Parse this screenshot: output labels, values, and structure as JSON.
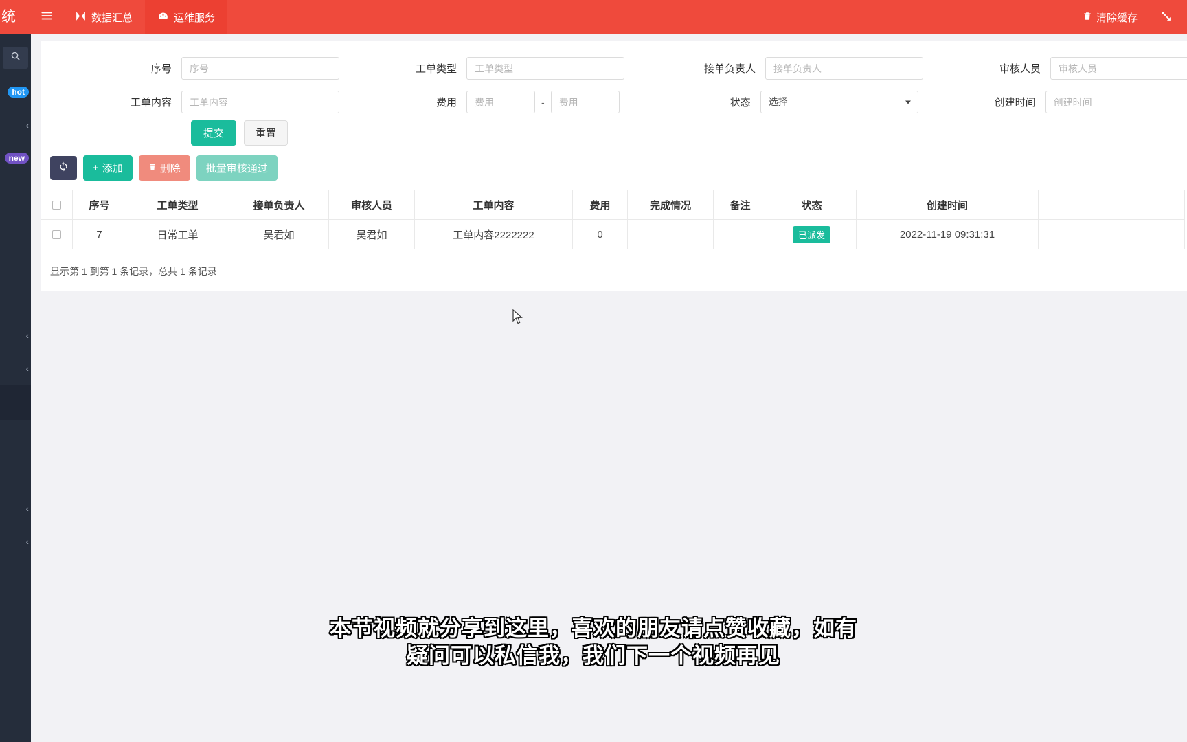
{
  "brand": {
    "title_fragment": "统"
  },
  "header": {
    "menu_toggle_icon": "hamburger-icon",
    "tabs": [
      {
        "label": "数据汇总",
        "icon": "chart-icon"
      },
      {
        "label": "运维服务",
        "icon": "gauge-icon"
      }
    ],
    "clear_cache_label": "清除缓存",
    "clear_cache_icon": "trash-icon",
    "fullscreen_icon": "fullscreen-icon"
  },
  "sidebar": {
    "search_icon": "search-icon",
    "items": [
      {
        "badge": "hot",
        "badge_type": "hot"
      },
      {
        "chevron": "‹"
      },
      {
        "badge": "new",
        "badge_type": "new"
      },
      {
        "chevron": "‹"
      },
      {
        "chevron": "‹"
      },
      {
        "chevron": "‹"
      },
      {
        "chevron": "‹"
      }
    ]
  },
  "search_form": {
    "fields": {
      "serial_no": {
        "label": "序号",
        "placeholder": "序号",
        "value": ""
      },
      "order_type": {
        "label": "工单类型",
        "placeholder": "工单类型",
        "value": ""
      },
      "owner": {
        "label": "接单负责人",
        "placeholder": "接单负责人",
        "value": ""
      },
      "reviewer": {
        "label": "审核人员",
        "placeholder": "审核人员",
        "value": ""
      },
      "order_content": {
        "label": "工单内容",
        "placeholder": "工单内容",
        "value": ""
      },
      "fee_min": {
        "label": "费用",
        "placeholder": "费用",
        "value": ""
      },
      "fee_sep": "-",
      "fee_max": {
        "placeholder": "费用",
        "value": ""
      },
      "status": {
        "label": "状态",
        "selected": "选择",
        "options": [
          "选择"
        ]
      },
      "created_at": {
        "label": "创建时间",
        "placeholder": "创建时间",
        "value": ""
      }
    },
    "submit_label": "提交",
    "reset_label": "重置"
  },
  "toolbar": {
    "refresh_icon": "refresh-icon",
    "add_label": "添加",
    "add_icon": "plus-icon",
    "delete_label": "删除",
    "delete_icon": "trash-icon",
    "batch_approve_label": "批量审核通过"
  },
  "table": {
    "columns": [
      "",
      "序号",
      "工单类型",
      "接单负责人",
      "审核人员",
      "工单内容",
      "费用",
      "完成情况",
      "备注",
      "状态",
      "创建时间",
      ""
    ],
    "rows": [
      {
        "serial_no": "7",
        "order_type": "日常工单",
        "owner": "吴君如",
        "reviewer": "吴君如",
        "order_content": "工单内容2222222",
        "fee": "0",
        "completion": "",
        "remark": "",
        "status": "已派发",
        "created_at": "2022-11-19 09:31:31"
      }
    ],
    "pager_text": "显示第 1 到第 1 条记录，总共 1 条记录"
  },
  "caption": {
    "line1": "本节视频就分享到这里，喜欢的朋友请点赞收藏，如有",
    "line2": "疑问可以私信我，我们下一个视频再见"
  },
  "colors": {
    "header_red": "#ef4a3c",
    "sidebar_dark": "#252d3b",
    "primary_green": "#1abc9c",
    "danger_salmon": "#f08b7d",
    "batch_teal": "#7dd3c0",
    "refresh_navy": "#3f4360",
    "badge_hot_blue": "#2196f3",
    "badge_new_purple": "#7152c4"
  }
}
